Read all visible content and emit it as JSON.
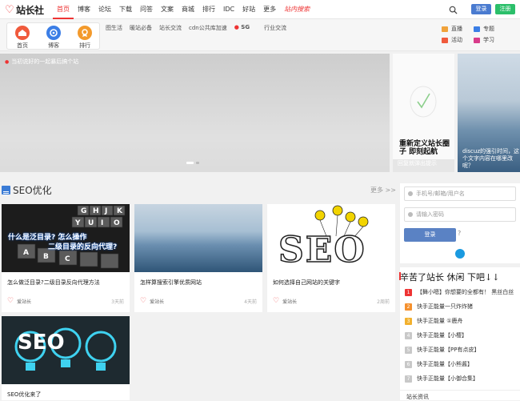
{
  "header": {
    "logo_text": "站长社",
    "nav": [
      "首页",
      "博客",
      "论坛",
      "下载",
      "问答",
      "文案",
      "商城",
      "排行",
      "IDC",
      "好站",
      "更多",
      "站内搜索"
    ],
    "login": "登录",
    "register": "注册"
  },
  "subbar": {
    "quick": [
      {
        "label": "首页",
        "color": "#f05a3c"
      },
      {
        "label": "博客",
        "color": "#3b7ee6"
      },
      {
        "label": "排行",
        "color": "#f39a2c"
      }
    ],
    "links": [
      "图生活",
      "暖站必备",
      "站长交流",
      "cdn公共库加速",
      "SG",
      "行业交流"
    ],
    "side_links": [
      {
        "label": "直播",
        "color": "#f0a23a"
      },
      {
        "label": "专题",
        "color": "#3b7ee6"
      },
      {
        "label": "活动",
        "color": "#f05a3c"
      },
      {
        "label": "学习",
        "color": "#d83b8a"
      }
    ]
  },
  "banner": {
    "caption": "当初说好的一起暴后搞个站"
  },
  "promo": [
    {
      "big": "重新定义站长圈子 即刻起航",
      "caption": "回复就弹出提示"
    },
    {
      "caption": "discuz的强引时间，这个文字内容在哪里改呢？"
    }
  ],
  "section": {
    "title": "SEO优化",
    "more": "更多 >>"
  },
  "posts": [
    {
      "title": "怎么做泛目录?二级目录反向代理方法",
      "author": "爱站长",
      "time": "3天前",
      "image_text": [
        "什么是泛目录? 怎么操作",
        "二级目录的反向代理?"
      ]
    },
    {
      "title": "怎样算搜索引擎优质网站",
      "author": "爱站长",
      "time": "4天前"
    },
    {
      "title": "如何选择自己网站的关键字",
      "author": "爱站长",
      "time": "2周前",
      "image_text": [
        "SEO"
      ]
    },
    {
      "title": "SEO优化来了",
      "author": "",
      "time": "",
      "image_text": [
        "SEO"
      ]
    }
  ],
  "login_box": {
    "user_placeholder": "手机号/邮箱/用户名",
    "pass_placeholder": "请输入密码",
    "submit": "登录",
    "help": "?"
  },
  "rank": {
    "title": "辛苦了站长  休闲  下吧↓↓",
    "items": [
      {
        "n": "1",
        "text": "【舞小嗯】你想要的全都有！ 黑丝白丝",
        "color": "#e33"
      },
      {
        "n": "2",
        "text": "快手正能量一只炸炸猪",
        "color": "#f5912e"
      },
      {
        "n": "3",
        "text": "快手正能量 ①鹿舟",
        "color": "#f2b12e"
      },
      {
        "n": "4",
        "text": "快手正能量【小樱】",
        "color": "#c8c8c8"
      },
      {
        "n": "5",
        "text": "快手正能量【PP有点皮】",
        "color": "#c8c8c8"
      },
      {
        "n": "6",
        "text": "快手正能量【小熊酱】",
        "color": "#c8c8c8"
      },
      {
        "n": "7",
        "text": "快手正能量【小御合集】",
        "color": "#c8c8c8"
      }
    ]
  },
  "bottom_tab": "站长资讯"
}
